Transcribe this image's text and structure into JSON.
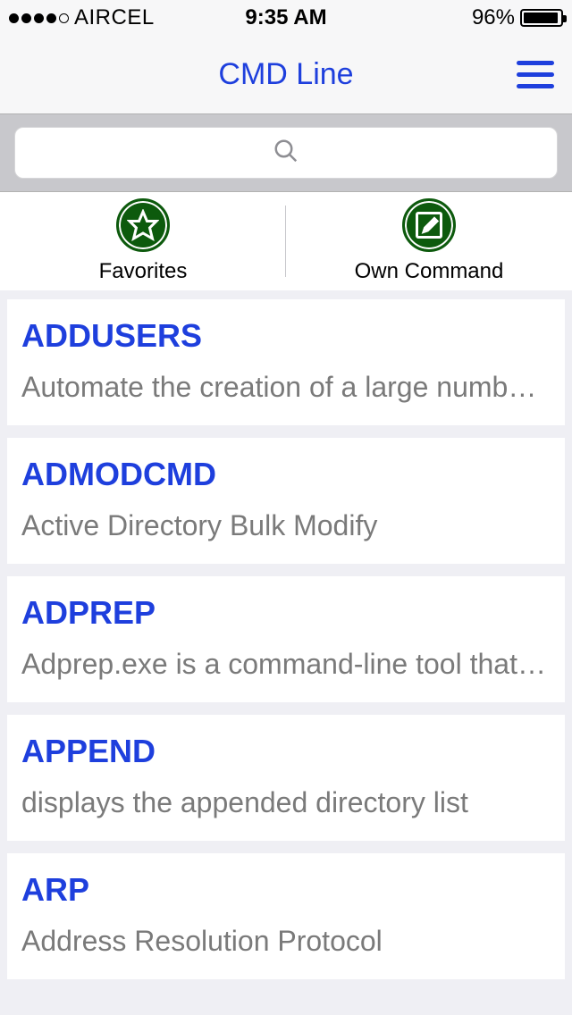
{
  "status": {
    "carrier": "AIRCEL",
    "time": "9:35 AM",
    "battery_percent": "96%"
  },
  "nav": {
    "title": "CMD Line"
  },
  "tabs": {
    "favorites": "Favorites",
    "own_command": "Own Command"
  },
  "commands": [
    {
      "name": "ADDUSERS",
      "desc": "Automate the creation of a large number of users"
    },
    {
      "name": "ADMODCMD",
      "desc": "Active Directory Bulk Modify"
    },
    {
      "name": "ADPREP",
      "desc": "Adprep.exe is a command-line tool that prepares a forest and domain"
    },
    {
      "name": "APPEND",
      "desc": "displays the appended directory list"
    },
    {
      "name": "ARP",
      "desc": "Address Resolution Protocol"
    }
  ]
}
